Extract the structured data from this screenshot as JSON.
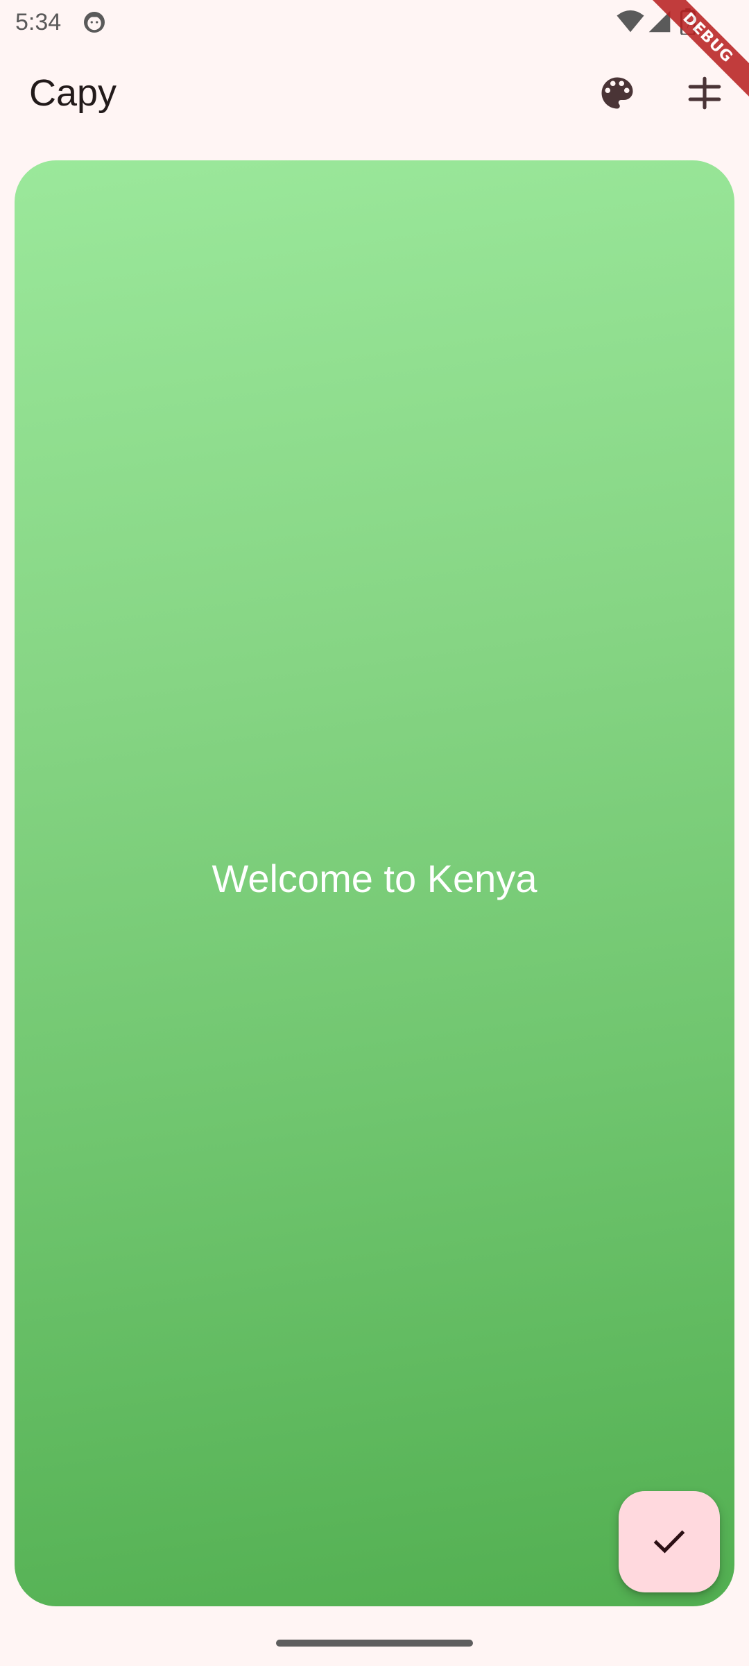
{
  "status_bar": {
    "time": "5:34",
    "icons": [
      "android-notification-icon",
      "wifi-icon",
      "cell-signal-icon",
      "battery-icon"
    ]
  },
  "debug_banner": {
    "label": "DEBUG"
  },
  "app_bar": {
    "title": "Capy",
    "actions": [
      "palette-icon",
      "filter-icon"
    ]
  },
  "card": {
    "message": "Welcome to Kenya",
    "gradient_colors": [
      "#9be89b",
      "#52af51"
    ]
  },
  "fab": {
    "icon": "check-icon",
    "color": "#ffd9de"
  },
  "colors": {
    "background": "#fff5f4",
    "on_surface": "#221a1a",
    "icon": "#4a3436"
  }
}
